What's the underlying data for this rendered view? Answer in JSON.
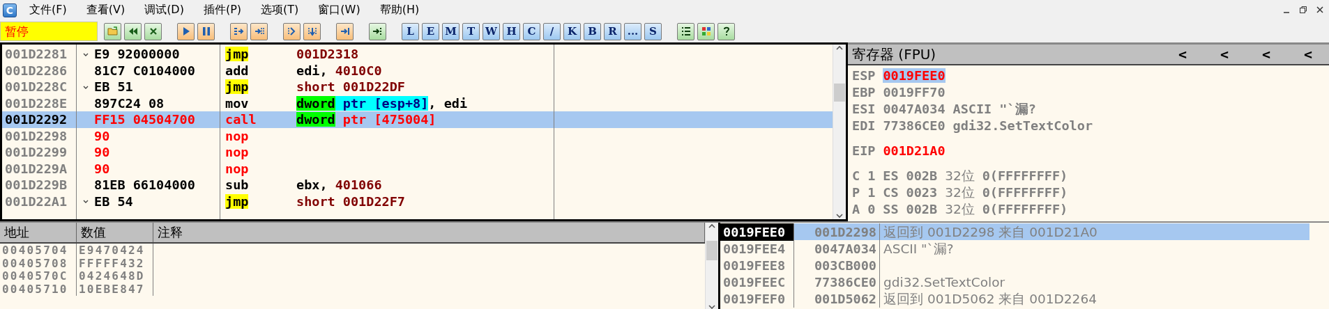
{
  "menu": {
    "app_icon": "C",
    "items": [
      "文件(F)",
      "查看(V)",
      "调试(D)",
      "插件(P)",
      "选项(T)",
      "窗口(W)",
      "帮助(H)"
    ]
  },
  "toolbar": {
    "status": "暂停",
    "window_buttons": [
      "L",
      "E",
      "M",
      "T",
      "W",
      "H",
      "C",
      "/",
      "K",
      "B",
      "R",
      "...",
      "S"
    ]
  },
  "disassembly": {
    "rows": [
      {
        "address": "001D2281",
        "jump_mark": true,
        "bytes": "E9 92000000",
        "mnemonic": "jmp",
        "highlighted": true,
        "modified": false,
        "selected": false,
        "operands": [
          {
            "text": "001D2318",
            "kind": "number"
          }
        ]
      },
      {
        "address": "001D2286",
        "jump_mark": false,
        "bytes": "81C7 C0104000",
        "mnemonic": "add",
        "highlighted": false,
        "modified": false,
        "selected": false,
        "operands": [
          {
            "text": "edi, ",
            "kind": "plain"
          },
          {
            "text": "4010C0",
            "kind": "number"
          }
        ]
      },
      {
        "address": "001D228C",
        "jump_mark": true,
        "bytes": "EB 51",
        "mnemonic": "jmp",
        "highlighted": true,
        "modified": false,
        "selected": false,
        "operands": [
          {
            "text": "short 001D22DF",
            "kind": "number"
          }
        ]
      },
      {
        "address": "001D228E",
        "jump_mark": false,
        "bytes": "897C24 08",
        "mnemonic": "mov",
        "highlighted": false,
        "modified": false,
        "selected": false,
        "operands": [
          {
            "text": "dword",
            "kind": "size"
          },
          {
            "text": " ptr [esp+8]",
            "kind": "memory"
          },
          {
            "text": ", edi",
            "kind": "plain"
          }
        ]
      },
      {
        "address": "001D2292",
        "jump_mark": false,
        "bytes": "FF15 04504700",
        "mnemonic": "call",
        "highlighted": false,
        "modified": true,
        "selected": true,
        "operands": [
          {
            "text": "dword",
            "kind": "size"
          },
          {
            "text": " ptr [475004]",
            "kind": "patched"
          }
        ]
      },
      {
        "address": "001D2298",
        "jump_mark": false,
        "bytes": "90",
        "mnemonic": "nop",
        "highlighted": false,
        "modified": true,
        "selected": false,
        "operands": []
      },
      {
        "address": "001D2299",
        "jump_mark": false,
        "bytes": "90",
        "mnemonic": "nop",
        "highlighted": false,
        "modified": true,
        "selected": false,
        "operands": []
      },
      {
        "address": "001D229A",
        "jump_mark": false,
        "bytes": "90",
        "mnemonic": "nop",
        "highlighted": false,
        "modified": true,
        "selected": false,
        "operands": []
      },
      {
        "address": "001D229B",
        "jump_mark": false,
        "bytes": "81EB 66104000",
        "mnemonic": "sub",
        "highlighted": false,
        "modified": false,
        "selected": false,
        "operands": [
          {
            "text": "ebx, ",
            "kind": "plain"
          },
          {
            "text": "401066",
            "kind": "number"
          }
        ]
      },
      {
        "address": "001D22A1",
        "jump_mark": true,
        "bytes": "EB 54",
        "mnemonic": "jmp",
        "highlighted": true,
        "modified": false,
        "selected": false,
        "operands": [
          {
            "text": "short 001D22F7",
            "kind": "number"
          }
        ]
      }
    ]
  },
  "registers": {
    "title": "寄存器 (FPU)",
    "arrows": [
      "<",
      "<",
      "<",
      "<"
    ],
    "general": [
      {
        "name": "ESP",
        "value": "0019FEE0",
        "changed": true,
        "selected": true
      },
      {
        "name": "EBP",
        "value": "0019FF70",
        "changed": false,
        "selected": false
      },
      {
        "name": "ESI",
        "value": "0047A034",
        "comment": "ASCII \"`漏?",
        "changed": false,
        "selected": false
      },
      {
        "name": "EDI",
        "value": "77386CE0",
        "comment": "gdi32.SetTextColor",
        "changed": false,
        "selected": false
      }
    ],
    "eip": {
      "name": "EIP",
      "value": "001D21A0",
      "changed": true
    },
    "segments": [
      {
        "flag": "C",
        "flag_value": "1",
        "segment": "ES",
        "selector": "002B",
        "bits": "32位",
        "limit": "0(FFFFFFFF)"
      },
      {
        "flag": "P",
        "flag_value": "1",
        "segment": "CS",
        "selector": "0023",
        "bits": "32位",
        "limit": "0(FFFFFFFF)"
      },
      {
        "flag": "A",
        "flag_value": "0",
        "segment": "SS",
        "selector": "002B",
        "bits": "32位",
        "limit": "0(FFFFFFFF)"
      }
    ]
  },
  "dump": {
    "columns": [
      "地址",
      "数值",
      "注释"
    ],
    "rows": [
      {
        "address": "00405704",
        "value": "E9470424"
      },
      {
        "address": "00405708",
        "value": "FFFFF432"
      },
      {
        "address": "0040570C",
        "value": "0424648D"
      },
      {
        "address": "00405710",
        "value": "10EBE847"
      }
    ]
  },
  "stack": {
    "rows": [
      {
        "address": "0019FEE0",
        "value": "001D2298",
        "comment": "返回到 001D2298 来自 001D21A0",
        "selected": true
      },
      {
        "address": "0019FEE4",
        "value": "0047A034",
        "comment": "ASCII \"`漏?",
        "selected": false
      },
      {
        "address": "0019FEE8",
        "value": "003CB000",
        "selected": false
      },
      {
        "address": "0019FEEC",
        "value": "77386CE0",
        "comment": "gdi32.SetTextColor",
        "selected": false
      },
      {
        "address": "0019FEF0",
        "value": "001D5062",
        "comment": "返回到 001D5062 来自 001D2264",
        "selected": false
      }
    ]
  }
}
